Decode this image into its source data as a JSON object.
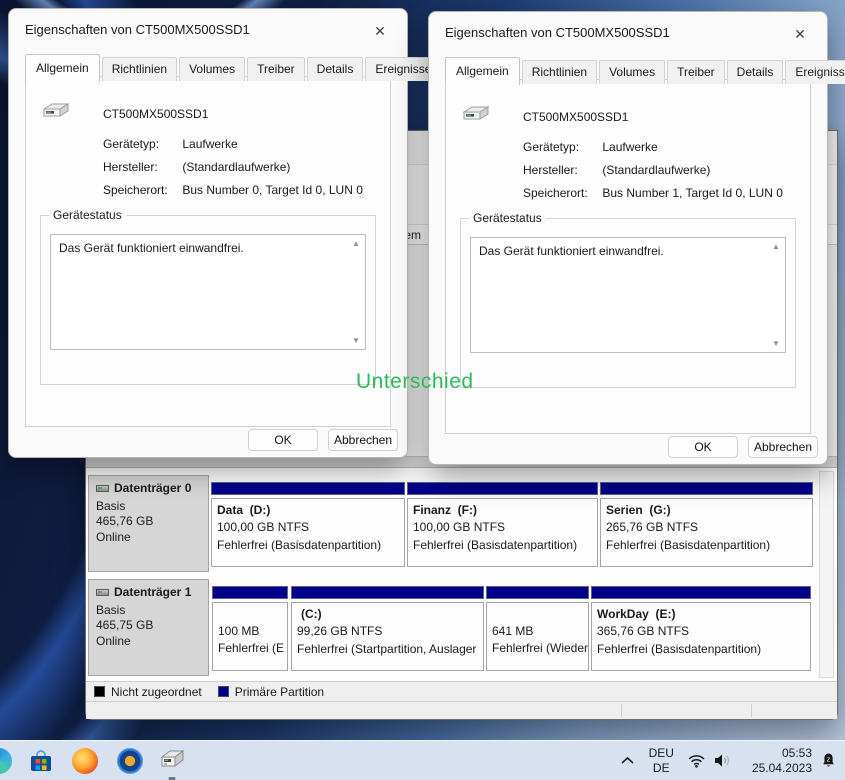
{
  "annotation": {
    "text": "Unterschied",
    "color": "#2eba5b"
  },
  "icons": {
    "close": "✕",
    "scroll_up": "▲",
    "scroll_down": "▼"
  },
  "dialogs": {
    "left": {
      "title": "Eigenschaften von CT500MX500SSD1",
      "tabs": [
        "Allgemein",
        "Richtlinien",
        "Volumes",
        "Treiber",
        "Details",
        "Ereignisse"
      ],
      "device_name": "CT500MX500SSD1",
      "fields": [
        {
          "label": "Gerätetyp:",
          "value": "Laufwerke"
        },
        {
          "label": "Hersteller:",
          "value": "(Standardlaufwerke)"
        },
        {
          "label": "Speicherort:",
          "value": "Bus Number 0, Target Id 0, LUN 0"
        }
      ],
      "group_title": "Gerätestatus",
      "status_text": "Das Gerät funktioniert einwandfrei.",
      "ok_label": "OK",
      "cancel_label": "Abbrechen"
    },
    "right": {
      "title": "Eigenschaften von CT500MX500SSD1",
      "tabs": [
        "Allgemein",
        "Richtlinien",
        "Volumes",
        "Treiber",
        "Details",
        "Ereignisse"
      ],
      "device_name": "CT500MX500SSD1",
      "fields": [
        {
          "label": "Gerätetyp:",
          "value": "Laufwerke"
        },
        {
          "label": "Hersteller:",
          "value": "(Standardlaufwerke)"
        },
        {
          "label": "Speicherort:",
          "value": "Bus Number 1, Target Id 0, LUN 0"
        }
      ],
      "group_title": "Gerätestatus",
      "status_text": "Das Gerät funktioniert einwandfrei.",
      "ok_label": "OK",
      "cancel_label": "Abbrechen"
    }
  },
  "disk_management": {
    "header_fragment": "tem",
    "disks": [
      {
        "name": "Datenträger 0",
        "type": "Basis",
        "size": "465,76 GB",
        "status": "Online",
        "partitions": [
          {
            "name": "Data  (D:)",
            "size": "100,00 GB NTFS",
            "status": "Fehlerfrei (Basisdatenpartition)"
          },
          {
            "name": "Finanz  (F:)",
            "size": "100,00 GB NTFS",
            "status": "Fehlerfrei (Basisdatenpartition)"
          },
          {
            "name": "Serien  (G:)",
            "size": "265,76 GB NTFS",
            "status": "Fehlerfrei (Basisdatenpartition)"
          }
        ]
      },
      {
        "name": "Datenträger 1",
        "type": "Basis",
        "size": "465,75 GB",
        "status": "Online",
        "partitions": [
          {
            "name": "",
            "size": "100 MB",
            "status": "Fehlerfrei (E"
          },
          {
            "name": "(C:)",
            "size": "99,26 GB NTFS",
            "status": "Fehlerfrei (Startpartition, Auslager"
          },
          {
            "name": "",
            "size": "641 MB",
            "status": "Fehlerfrei (Wieder"
          },
          {
            "name": "WorkDay  (E:)",
            "size": "365,76 GB NTFS",
            "status": "Fehlerfrei (Basisdatenpartition)"
          }
        ]
      }
    ],
    "legend": [
      {
        "label": "Nicht zugeordnet",
        "color": "#000000"
      },
      {
        "label": "Primäre Partition",
        "color": "#00008b"
      }
    ]
  },
  "taskbar": {
    "language_line1": "DEU",
    "language_line2": "DE",
    "clock_time": "05:53",
    "clock_date": "25.04.2023"
  }
}
